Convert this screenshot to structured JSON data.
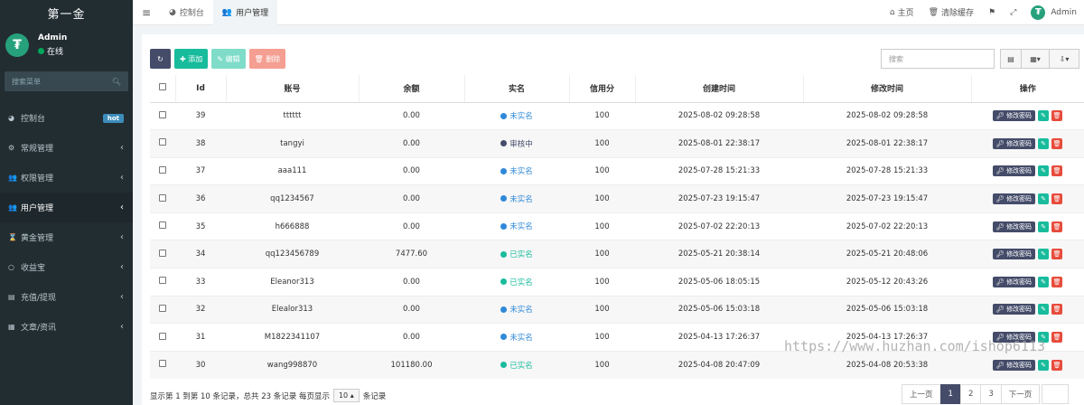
{
  "brand": "第一金",
  "user": {
    "name": "Admin",
    "status": "在线"
  },
  "search_menu_placeholder": "搜索菜单",
  "menu": [
    {
      "icon": "dashboard-icon",
      "glyph": "◕",
      "label": "控制台",
      "badge": "hot"
    },
    {
      "icon": "cogs-icon",
      "glyph": "⚙",
      "label": "常规管理",
      "arrow": "‹"
    },
    {
      "icon": "group-icon",
      "glyph": "👥",
      "label": "权限管理",
      "arrow": "‹"
    },
    {
      "icon": "users-icon",
      "glyph": "👥",
      "label": "用户管理",
      "arrow": "‹",
      "active": true
    },
    {
      "icon": "hourglass-icon",
      "glyph": "⌛",
      "label": "黄金管理",
      "arrow": "‹"
    },
    {
      "icon": "circle-icon",
      "glyph": "○",
      "label": "收益宝",
      "arrow": "‹"
    },
    {
      "icon": "list-icon",
      "glyph": "▤",
      "label": "充值/提现",
      "arrow": "‹"
    },
    {
      "icon": "newspaper-icon",
      "glyph": "▦",
      "label": "文章/资讯",
      "arrow": "‹"
    }
  ],
  "topbar": {
    "tabs": [
      {
        "icon": "dashboard-icon",
        "label": "控制台"
      },
      {
        "icon": "users-icon",
        "label": "用户管理"
      }
    ],
    "home": "主页",
    "clear_cache": "清除缓存",
    "admin": "Admin"
  },
  "toolbar": {
    "add": "添加",
    "edit": "编辑",
    "delete": "删除",
    "search_placeholder": "搜索"
  },
  "columns": [
    "Id",
    "账号",
    "余额",
    "实名",
    "信用分",
    "创建时间",
    "修改时间",
    "操作"
  ],
  "status_colors": {
    "未实名": "#2f89d8",
    "审核中": "#444c69",
    "已实名": "#18bc9c"
  },
  "op_labels": {
    "change_password": "修改密码"
  },
  "rows": [
    {
      "id": "39",
      "account": "tttttt",
      "balance": "0.00",
      "status": "未实名",
      "credit": "100",
      "created": "2025-08-02 09:28:58",
      "updated": "2025-08-02 09:28:58"
    },
    {
      "id": "38",
      "account": "tangyi",
      "balance": "0.00",
      "status": "审核中",
      "credit": "100",
      "created": "2025-08-01 22:38:17",
      "updated": "2025-08-01 22:38:17"
    },
    {
      "id": "37",
      "account": "aaa111",
      "balance": "0.00",
      "status": "未实名",
      "credit": "100",
      "created": "2025-07-28 15:21:33",
      "updated": "2025-07-28 15:21:33"
    },
    {
      "id": "36",
      "account": "qq1234567",
      "balance": "0.00",
      "status": "未实名",
      "credit": "100",
      "created": "2025-07-23 19:15:47",
      "updated": "2025-07-23 19:15:47"
    },
    {
      "id": "35",
      "account": "h666888",
      "balance": "0.00",
      "status": "未实名",
      "credit": "100",
      "created": "2025-07-02 22:20:13",
      "updated": "2025-07-02 22:20:13"
    },
    {
      "id": "34",
      "account": "qq123456789",
      "balance": "7477.60",
      "status": "已实名",
      "credit": "100",
      "created": "2025-05-21 20:38:14",
      "updated": "2025-05-21 20:48:06"
    },
    {
      "id": "33",
      "account": "Eleanor313",
      "balance": "0.00",
      "status": "已实名",
      "credit": "100",
      "created": "2025-05-06 18:05:15",
      "updated": "2025-05-12 20:43:26"
    },
    {
      "id": "32",
      "account": "Elealor313",
      "balance": "0.00",
      "status": "未实名",
      "credit": "100",
      "created": "2025-05-06 15:03:18",
      "updated": "2025-05-06 15:03:18"
    },
    {
      "id": "31",
      "account": "M1822341107",
      "balance": "0.00",
      "status": "未实名",
      "credit": "100",
      "created": "2025-04-13 17:26:37",
      "updated": "2025-04-13 17:26:37"
    },
    {
      "id": "30",
      "account": "wang998870",
      "balance": "101180.00",
      "status": "已实名",
      "credit": "100",
      "created": "2025-04-08 20:47:09",
      "updated": "2025-04-08 20:53:38"
    }
  ],
  "footer": {
    "summary": "显示第 1 到第 10 条记录，总共 23 条记录 每页显示",
    "page_size": "10",
    "suffix": "条记录"
  },
  "pagination": {
    "prev": "上一页",
    "pages": [
      "1",
      "2",
      "3"
    ],
    "current": "1",
    "next": "下一页"
  },
  "watermark": "https://www.huzhan.com/ishop6113"
}
